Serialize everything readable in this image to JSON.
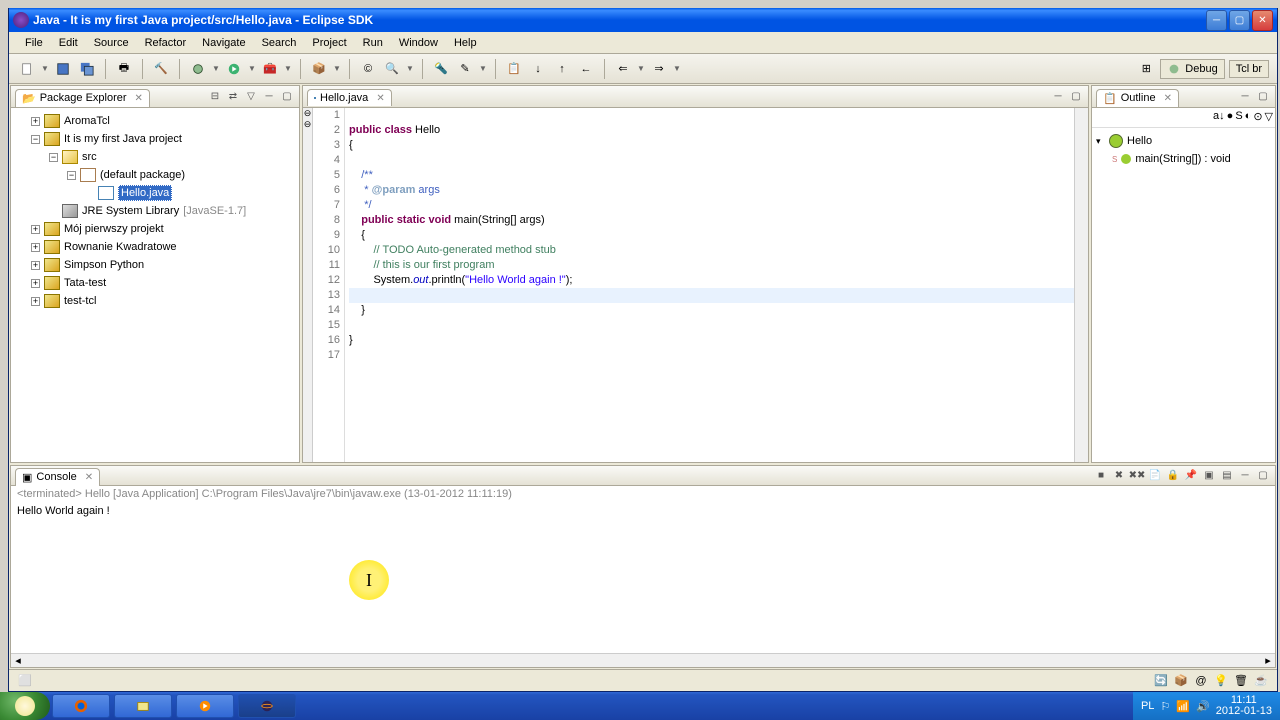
{
  "window": {
    "title": "Java - It is my first Java project/src/Hello.java - Eclipse SDK"
  },
  "menus": [
    "File",
    "Edit",
    "Source",
    "Refactor",
    "Navigate",
    "Search",
    "Project",
    "Run",
    "Window",
    "Help"
  ],
  "perspectives": {
    "debug": "Debug",
    "tcl": "Tcl br"
  },
  "package_explorer": {
    "title": "Package Explorer",
    "projects": [
      {
        "name": "AromaTcl",
        "expanded": false
      },
      {
        "name": "It is my first Java project",
        "expanded": true,
        "children": [
          {
            "name": "src",
            "type": "folder",
            "expanded": true,
            "children": [
              {
                "name": "(default package)",
                "type": "package",
                "expanded": true,
                "children": [
                  {
                    "name": "Hello.java",
                    "type": "java",
                    "selected": true
                  }
                ]
              }
            ]
          },
          {
            "name": "JRE System Library",
            "type": "jre",
            "suffix": "[JavaSE-1.7]"
          }
        ]
      },
      {
        "name": "Mój pierwszy projekt",
        "expanded": false
      },
      {
        "name": "Rownanie Kwadratowe",
        "expanded": false
      },
      {
        "name": "Simpson Python",
        "expanded": false
      },
      {
        "name": "Tata-test",
        "expanded": false
      },
      {
        "name": "test-tcl",
        "expanded": false
      }
    ]
  },
  "editor": {
    "tab": "Hello.java",
    "lines": [
      {
        "n": "1",
        "parts": []
      },
      {
        "n": "2",
        "parts": [
          {
            "t": "public",
            "c": "kw"
          },
          {
            "t": " "
          },
          {
            "t": "class",
            "c": "kw"
          },
          {
            "t": " Hello"
          }
        ]
      },
      {
        "n": "3",
        "parts": [
          {
            "t": "{"
          }
        ]
      },
      {
        "n": "4",
        "parts": []
      },
      {
        "n": "5",
        "marker": "⊖",
        "parts": [
          {
            "t": "    "
          },
          {
            "t": "/**",
            "c": "doc"
          }
        ]
      },
      {
        "n": "6",
        "parts": [
          {
            "t": "     "
          },
          {
            "t": "* ",
            "c": "doc"
          },
          {
            "t": "@param",
            "c": "doctag"
          },
          {
            "t": " args",
            "c": "doc"
          }
        ]
      },
      {
        "n": "7",
        "parts": [
          {
            "t": "     "
          },
          {
            "t": "*/",
            "c": "doc"
          }
        ]
      },
      {
        "n": "8",
        "marker": "⊖",
        "parts": [
          {
            "t": "    "
          },
          {
            "t": "public",
            "c": "kw"
          },
          {
            "t": " "
          },
          {
            "t": "static",
            "c": "kw"
          },
          {
            "t": " "
          },
          {
            "t": "void",
            "c": "kw"
          },
          {
            "t": " main(String[] args)"
          }
        ]
      },
      {
        "n": "9",
        "parts": [
          {
            "t": "    {"
          }
        ]
      },
      {
        "n": "10",
        "parts": [
          {
            "t": "        "
          },
          {
            "t": "// ",
            "c": "comment"
          },
          {
            "t": "TODO",
            "c": "comment"
          },
          {
            "t": " Auto-generated method stub",
            "c": "comment"
          }
        ]
      },
      {
        "n": "11",
        "parts": [
          {
            "t": "        "
          },
          {
            "t": "// this is our first program",
            "c": "comment"
          }
        ]
      },
      {
        "n": "12",
        "parts": [
          {
            "t": "        System."
          },
          {
            "t": "out",
            "c": "field"
          },
          {
            "t": ".println("
          },
          {
            "t": "\"Hello World again !\"",
            "c": "string"
          },
          {
            "t": ");"
          }
        ]
      },
      {
        "n": "13",
        "hl": true,
        "parts": []
      },
      {
        "n": "14",
        "parts": [
          {
            "t": "    }"
          }
        ]
      },
      {
        "n": "15",
        "parts": []
      },
      {
        "n": "16",
        "parts": [
          {
            "t": "}"
          }
        ]
      },
      {
        "n": "17",
        "parts": []
      }
    ]
  },
  "outline": {
    "title": "Outline",
    "items": [
      {
        "name": "Hello",
        "type": "class"
      },
      {
        "name": "main(String[]) : void",
        "type": "method",
        "prefix": "S"
      }
    ]
  },
  "console": {
    "title": "Console",
    "info": "<terminated> Hello [Java Application] C:\\Program Files\\Java\\jre7\\bin\\javaw.exe (13-01-2012 11:11:19)",
    "output": "Hello World again !"
  },
  "tray": {
    "lang": "PL",
    "time": "11:11",
    "date": "2012-01-13"
  }
}
